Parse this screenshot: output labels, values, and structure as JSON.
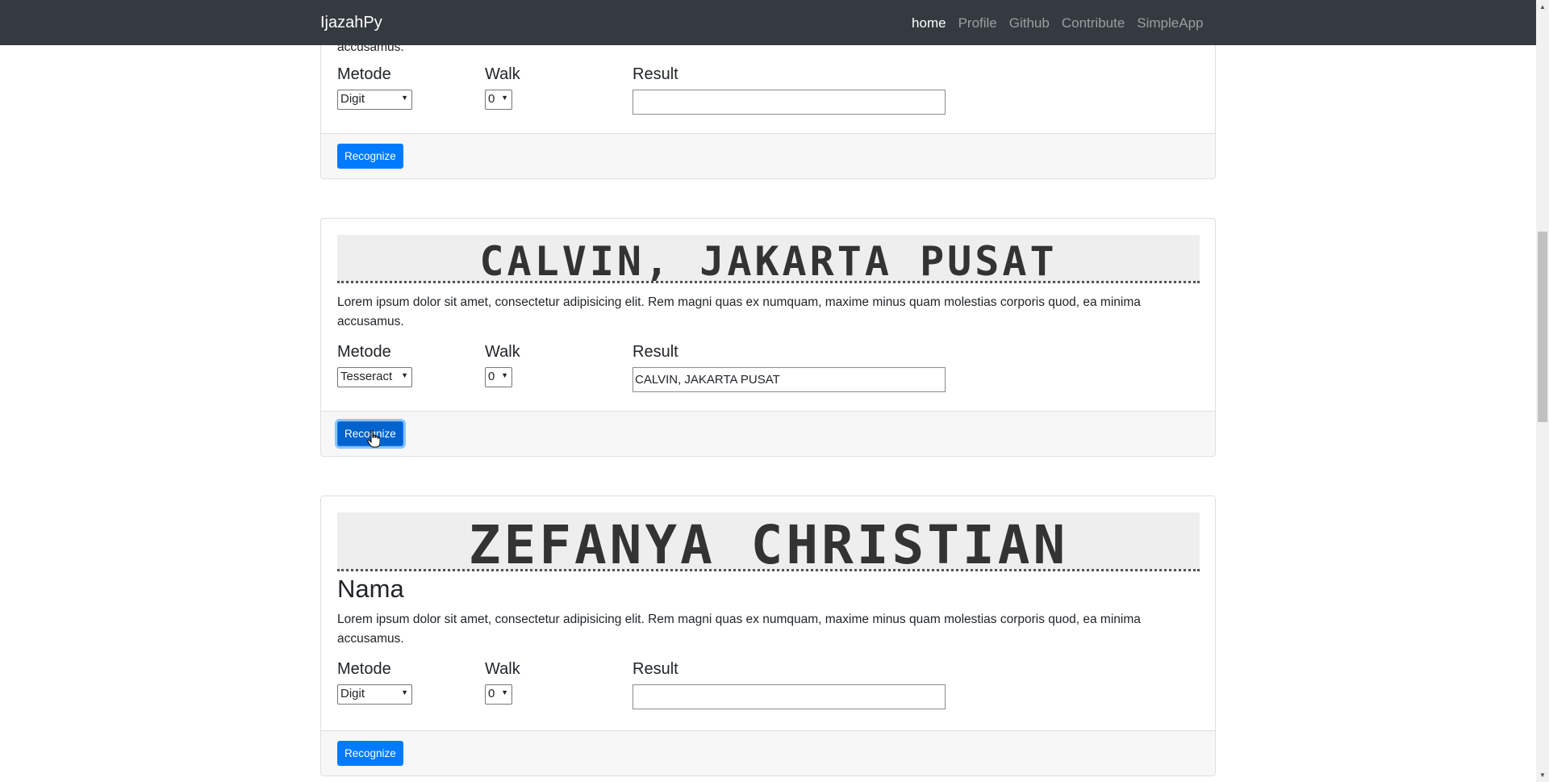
{
  "navbar": {
    "brand": "IjazahPy",
    "links": [
      {
        "label": "home",
        "active": true
      },
      {
        "label": "Profile",
        "active": false
      },
      {
        "label": "Github",
        "active": false
      },
      {
        "label": "Contribute",
        "active": false
      },
      {
        "label": "SimpleApp",
        "active": false
      }
    ]
  },
  "cards": [
    {
      "description_partial": "accusamus.",
      "metode_label": "Metode",
      "metode_value": "Digit",
      "walk_label": "Walk",
      "walk_value": "0",
      "result_label": "Result",
      "result_value": "",
      "button_label": "Recognize"
    },
    {
      "image_text": "CALVIN, JAKARTA PUSAT",
      "description": "Lorem ipsum dolor sit amet, consectetur adipisicing elit. Rem magni quas ex numquam, maxime minus quam molestias corporis quod, ea minima accusamus.",
      "metode_label": "Metode",
      "metode_value": "Tesseract",
      "walk_label": "Walk",
      "walk_value": "0",
      "result_label": "Result",
      "result_value": "CALVIN, JAKARTA PUSAT",
      "button_label": "Recognize"
    },
    {
      "image_text": "ZEFANYA CHRISTIAN",
      "title": "Nama",
      "description": "Lorem ipsum dolor sit amet, consectetur adipisicing elit. Rem magni quas ex numquam, maxime minus quam molestias corporis quod, ea minima accusamus.",
      "metode_label": "Metode",
      "metode_value": "Digit",
      "walk_label": "Walk",
      "walk_value": "0",
      "result_label": "Result",
      "result_value": "",
      "button_label": "Recognize"
    }
  ],
  "colors": {
    "navbar_bg": "#343a40",
    "primary": "#007bff",
    "footer_bg": "#f7f7f7"
  }
}
